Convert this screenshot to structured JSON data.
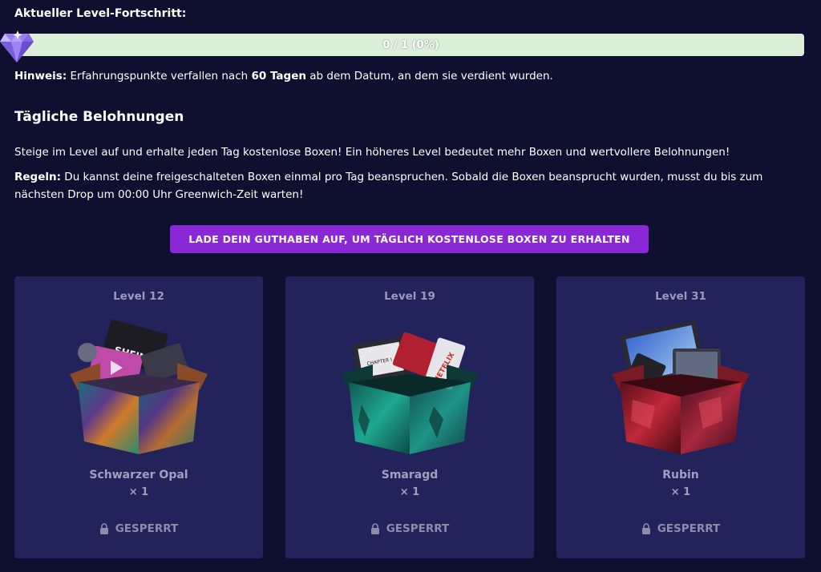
{
  "progress": {
    "label": "Aktueller Level-Fortschritt:",
    "text": "0 / 1 (0%)",
    "fraction": 0,
    "gem_icon": "diamond-gem-icon"
  },
  "hint": {
    "prefix": "Hinweis:",
    "text_before": " Erfahrungspunkte verfallen nach ",
    "days": "60 Tagen",
    "text_after": " ab dem Datum, an dem sie verdient wurden."
  },
  "daily": {
    "title": "Tägliche Belohnungen",
    "description": "Steige im Level auf und erhalte jeden Tag kostenlose Boxen! Ein höheres Level bedeutet mehr Boxen und wertvollere Belohnungen!",
    "rules_prefix": "Regeln:",
    "rules_text": " Du kannst deine freigeschalteten Boxen einmal pro Tag beanspruchen. Sobald die Boxen beansprucht wurden, musst du bis zum nächsten Drop um 00:00 Uhr Greenwich-Zeit warten!",
    "cta_label": "LADE DEIN GUTHABEN AUF, UM TÄGLICH KOSTENLOSE BOXEN ZU ERHALTEN"
  },
  "cards": [
    {
      "level": "Level 12",
      "name": "Schwarzer Opal",
      "qty": "× 1",
      "status": "GESPERRT",
      "box_label": "SHEIN",
      "theme": "opal"
    },
    {
      "level": "Level 19",
      "name": "Smaragd",
      "qty": "× 1",
      "status": "GESPERRT",
      "box_label": "NETFLIX",
      "box_label2": "CHAPTER I",
      "theme": "emerald"
    },
    {
      "level": "Level 31",
      "name": "Rubin",
      "qty": "× 1",
      "status": "GESPERRT",
      "theme": "ruby"
    }
  ],
  "colors": {
    "background": "#0f1030",
    "card": "#22235a",
    "accent_button": "#8a27d6",
    "progress_track": "#dcefd9"
  }
}
